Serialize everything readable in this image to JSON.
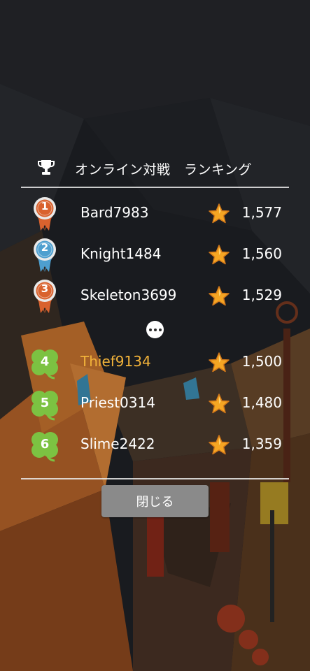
{
  "header": {
    "trophy_icon": "trophy-icon",
    "title": "オンライン対戦　ランキング"
  },
  "leaderboard": [
    {
      "rank": "1",
      "badge": "medal",
      "medal_color": "#d9622e",
      "name": "Bard7983",
      "score": "1,577",
      "self": false
    },
    {
      "rank": "2",
      "badge": "medal",
      "medal_color": "#4e9fcf",
      "name": "Knight1484",
      "score": "1,560",
      "self": false
    },
    {
      "rank": "3",
      "badge": "medal",
      "medal_color": "#d9622e",
      "name": "Skeleton3699",
      "score": "1,529",
      "self": false
    },
    {
      "rank": "4",
      "badge": "clover",
      "name": "Thief9134",
      "score": "1,500",
      "self": true
    },
    {
      "rank": "5",
      "badge": "clover",
      "name": "Priest0314",
      "score": "1,480",
      "self": false
    },
    {
      "rank": "6",
      "badge": "clover",
      "name": "Slime2422",
      "score": "1,359",
      "self": false
    }
  ],
  "colors": {
    "self_name": "#f2b33a",
    "star": "#f5a623",
    "clover": "#7cc242",
    "button": "#8a8a8a"
  },
  "more_icon": "ellipsis-icon",
  "close_button": {
    "label": "閉じる"
  }
}
